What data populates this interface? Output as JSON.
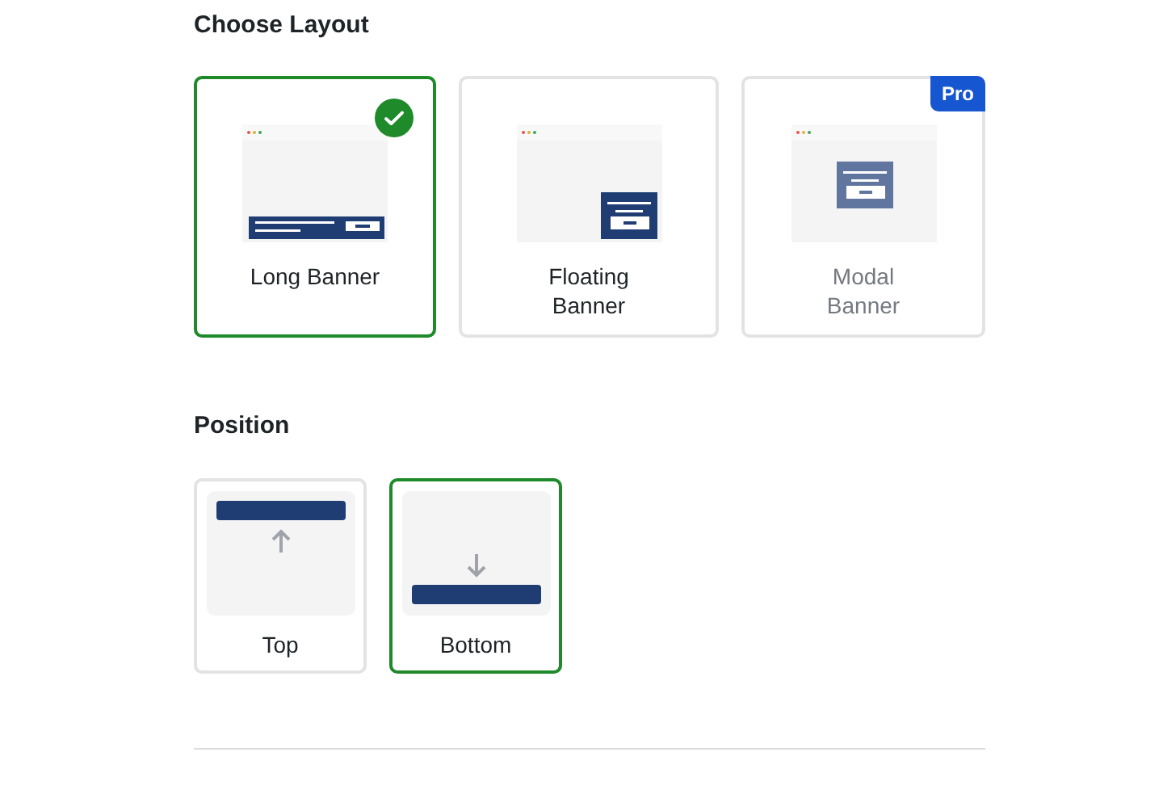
{
  "layout_section": {
    "title": "Choose Layout",
    "options": [
      {
        "label": "Long Banner",
        "kind": "long",
        "selected": true,
        "disabled": false
      },
      {
        "label": "Floating Banner",
        "kind": "floating",
        "selected": false,
        "disabled": false
      },
      {
        "label": "Modal Banner",
        "kind": "modal",
        "selected": false,
        "pro_badge": "Pro",
        "disabled": true
      }
    ]
  },
  "position_section": {
    "title": "Position",
    "options": [
      {
        "label": "Top",
        "kind": "top",
        "selected": false
      },
      {
        "label": "Bottom",
        "kind": "bottom",
        "selected": true
      }
    ]
  }
}
